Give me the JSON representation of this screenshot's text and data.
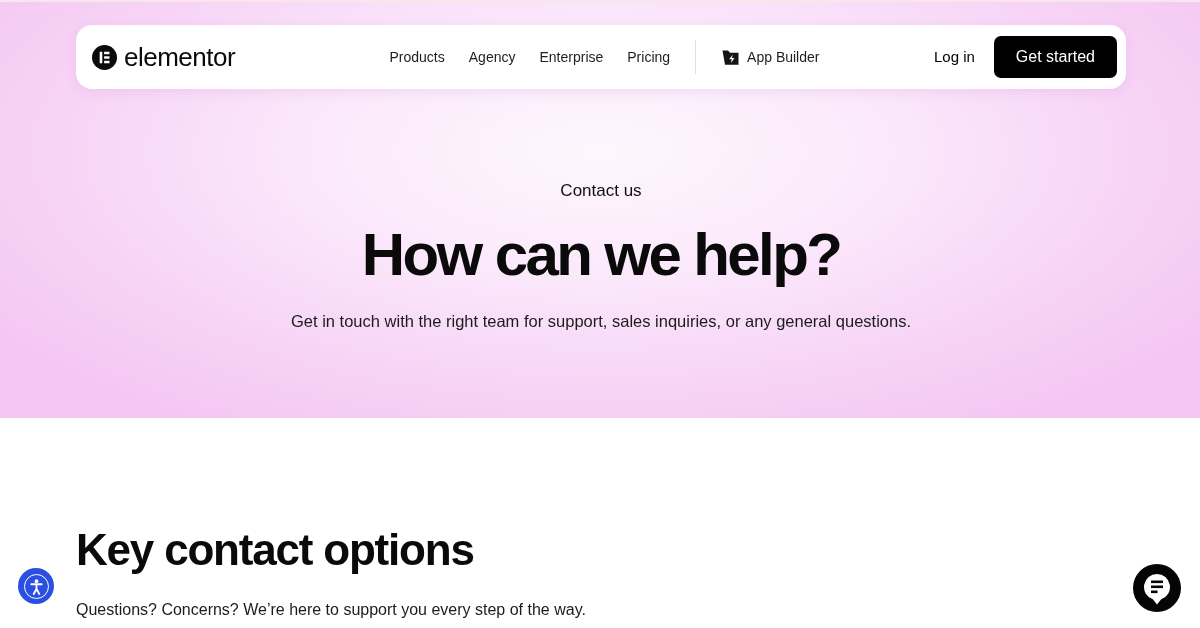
{
  "nav": {
    "brand": "elementor",
    "links": [
      "Products",
      "Agency",
      "Enterprise",
      "Pricing"
    ],
    "app_builder": "App Builder",
    "login": "Log in",
    "cta": "Get started"
  },
  "hero": {
    "eyebrow": "Contact us",
    "title": "How can we help?",
    "subtitle": "Get in touch with the right team for support, sales inquiries, or any general questions."
  },
  "contact_options": {
    "title": "Key contact options",
    "subtitle": "Questions? Concerns? We’re here to support you every step of the way."
  }
}
